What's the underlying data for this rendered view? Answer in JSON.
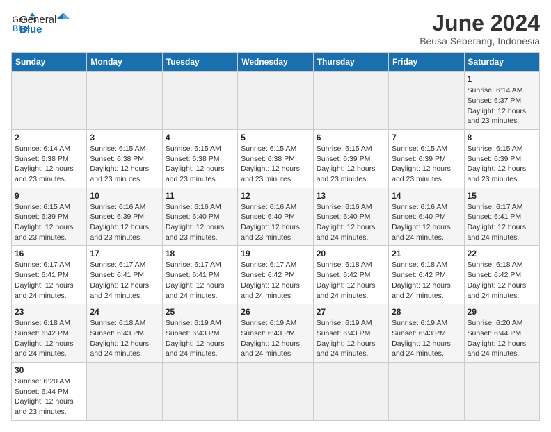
{
  "logo": {
    "text_general": "General",
    "text_blue": "Blue"
  },
  "title": "June 2024",
  "subtitle": "Beusa Seberang, Indonesia",
  "days_of_week": [
    "Sunday",
    "Monday",
    "Tuesday",
    "Wednesday",
    "Thursday",
    "Friday",
    "Saturday"
  ],
  "weeks": [
    [
      {
        "day": "",
        "info": ""
      },
      {
        "day": "",
        "info": ""
      },
      {
        "day": "",
        "info": ""
      },
      {
        "day": "",
        "info": ""
      },
      {
        "day": "",
        "info": ""
      },
      {
        "day": "",
        "info": ""
      },
      {
        "day": "1",
        "info": "Sunrise: 6:14 AM\nSunset: 6:37 PM\nDaylight: 12 hours and 23 minutes."
      }
    ],
    [
      {
        "day": "2",
        "info": "Sunrise: 6:14 AM\nSunset: 6:38 PM\nDaylight: 12 hours and 23 minutes."
      },
      {
        "day": "3",
        "info": "Sunrise: 6:15 AM\nSunset: 6:38 PM\nDaylight: 12 hours and 23 minutes."
      },
      {
        "day": "4",
        "info": "Sunrise: 6:15 AM\nSunset: 6:38 PM\nDaylight: 12 hours and 23 minutes."
      },
      {
        "day": "5",
        "info": "Sunrise: 6:15 AM\nSunset: 6:38 PM\nDaylight: 12 hours and 23 minutes."
      },
      {
        "day": "6",
        "info": "Sunrise: 6:15 AM\nSunset: 6:39 PM\nDaylight: 12 hours and 23 minutes."
      },
      {
        "day": "7",
        "info": "Sunrise: 6:15 AM\nSunset: 6:39 PM\nDaylight: 12 hours and 23 minutes."
      },
      {
        "day": "8",
        "info": "Sunrise: 6:15 AM\nSunset: 6:39 PM\nDaylight: 12 hours and 23 minutes."
      }
    ],
    [
      {
        "day": "9",
        "info": "Sunrise: 6:15 AM\nSunset: 6:39 PM\nDaylight: 12 hours and 23 minutes."
      },
      {
        "day": "10",
        "info": "Sunrise: 6:16 AM\nSunset: 6:39 PM\nDaylight: 12 hours and 23 minutes."
      },
      {
        "day": "11",
        "info": "Sunrise: 6:16 AM\nSunset: 6:40 PM\nDaylight: 12 hours and 23 minutes."
      },
      {
        "day": "12",
        "info": "Sunrise: 6:16 AM\nSunset: 6:40 PM\nDaylight: 12 hours and 23 minutes."
      },
      {
        "day": "13",
        "info": "Sunrise: 6:16 AM\nSunset: 6:40 PM\nDaylight: 12 hours and 24 minutes."
      },
      {
        "day": "14",
        "info": "Sunrise: 6:16 AM\nSunset: 6:40 PM\nDaylight: 12 hours and 24 minutes."
      },
      {
        "day": "15",
        "info": "Sunrise: 6:17 AM\nSunset: 6:41 PM\nDaylight: 12 hours and 24 minutes."
      }
    ],
    [
      {
        "day": "16",
        "info": "Sunrise: 6:17 AM\nSunset: 6:41 PM\nDaylight: 12 hours and 24 minutes."
      },
      {
        "day": "17",
        "info": "Sunrise: 6:17 AM\nSunset: 6:41 PM\nDaylight: 12 hours and 24 minutes."
      },
      {
        "day": "18",
        "info": "Sunrise: 6:17 AM\nSunset: 6:41 PM\nDaylight: 12 hours and 24 minutes."
      },
      {
        "day": "19",
        "info": "Sunrise: 6:17 AM\nSunset: 6:42 PM\nDaylight: 12 hours and 24 minutes."
      },
      {
        "day": "20",
        "info": "Sunrise: 6:18 AM\nSunset: 6:42 PM\nDaylight: 12 hours and 24 minutes."
      },
      {
        "day": "21",
        "info": "Sunrise: 6:18 AM\nSunset: 6:42 PM\nDaylight: 12 hours and 24 minutes."
      },
      {
        "day": "22",
        "info": "Sunrise: 6:18 AM\nSunset: 6:42 PM\nDaylight: 12 hours and 24 minutes."
      }
    ],
    [
      {
        "day": "23",
        "info": "Sunrise: 6:18 AM\nSunset: 6:42 PM\nDaylight: 12 hours and 24 minutes."
      },
      {
        "day": "24",
        "info": "Sunrise: 6:18 AM\nSunset: 6:43 PM\nDaylight: 12 hours and 24 minutes."
      },
      {
        "day": "25",
        "info": "Sunrise: 6:19 AM\nSunset: 6:43 PM\nDaylight: 12 hours and 24 minutes."
      },
      {
        "day": "26",
        "info": "Sunrise: 6:19 AM\nSunset: 6:43 PM\nDaylight: 12 hours and 24 minutes."
      },
      {
        "day": "27",
        "info": "Sunrise: 6:19 AM\nSunset: 6:43 PM\nDaylight: 12 hours and 24 minutes."
      },
      {
        "day": "28",
        "info": "Sunrise: 6:19 AM\nSunset: 6:43 PM\nDaylight: 12 hours and 24 minutes."
      },
      {
        "day": "29",
        "info": "Sunrise: 6:20 AM\nSunset: 6:44 PM\nDaylight: 12 hours and 24 minutes."
      }
    ],
    [
      {
        "day": "30",
        "info": "Sunrise: 6:20 AM\nSunset: 6:44 PM\nDaylight: 12 hours and 23 minutes."
      },
      {
        "day": "",
        "info": ""
      },
      {
        "day": "",
        "info": ""
      },
      {
        "day": "",
        "info": ""
      },
      {
        "day": "",
        "info": ""
      },
      {
        "day": "",
        "info": ""
      },
      {
        "day": "",
        "info": ""
      }
    ]
  ]
}
